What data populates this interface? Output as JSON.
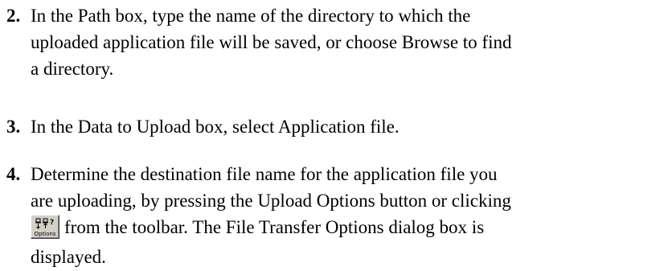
{
  "steps": [
    {
      "number": "2.",
      "lines": [
        "In the Path box, type the name of the directory to which the",
        "uploaded application file will be saved, or choose Browse to find",
        "a directory."
      ]
    },
    {
      "number": "3.",
      "lines": [
        "In the Data to Upload box, select Application file."
      ]
    },
    {
      "number": "4.",
      "lines": [
        "Determine the destination file name for the application file you",
        "are uploading, by pressing the Upload Options button or clicking"
      ],
      "inline_line_after_icon": "from the toolbar. The File Transfer Options dialog box is",
      "last_line": "displayed."
    }
  ],
  "toolbar_button": {
    "label": "Options",
    "icon": "options-icon"
  }
}
